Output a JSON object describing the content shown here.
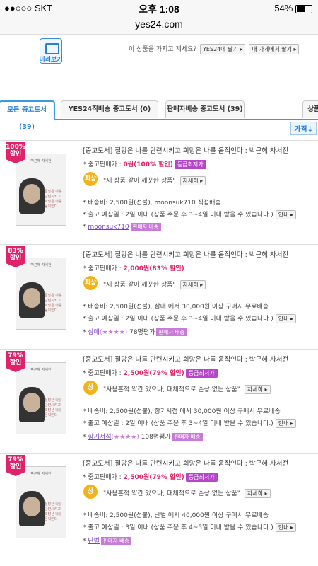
{
  "status": {
    "carrier": "●●○○○ SKT",
    "time": "오후 1:08",
    "battery": "54%"
  },
  "url": "yes24.com",
  "top": {
    "preview_label": "미리보기",
    "have_text": "이 상품을 가지고 계세요?",
    "btn_sell_yes24": "YES24에 팔기 ▸",
    "btn_sell_mystore": "내 가게에서 팔기 ▸"
  },
  "tabs": [
    "모든 중고도서 (39)",
    "YES24직배송 중고도서 (0)",
    "판매자배송 중고도서 (39)",
    "상품"
  ],
  "sort_label": "가격↓",
  "items": [
    {
      "discount": "100%",
      "disc_word": "할인",
      "title": "[중고도서] 절망은 나를 단련시키고 희망은 나를 움직인다 : 박근혜 자서전",
      "price_label": "* 중고판매가 :",
      "price": "0원",
      "pct": "(100% 할인)",
      "best": "등급최저가",
      "grade": "최상",
      "quote": "\"새 상품 같이 깨끗한 상품\"",
      "detail": "자세히 ▸",
      "ship": "* 배송비: 2,500원(선불), moonsuk710 직접배송",
      "eta": "* 출고 예상일 : 2일 이내 (상품 주문 후 3~4일 이내 받을 수 있습니다.)",
      "guide": "안내 ▸",
      "seller": "moonsuk710",
      "seller_badge": "판매자 배송",
      "stars": "",
      "rating": ""
    },
    {
      "discount": "83%",
      "disc_word": "할인",
      "title": "[중고도서] 절망은 나를 단련시키고 희망은 나를 움직인다 : 박근혜 자서전",
      "price_label": "* 중고판매가 :",
      "price": "2,000원",
      "pct": "(83% 할인)",
      "best": "",
      "grade": "최상",
      "quote": "\"새 상품 같이 깨끗한 상품\"",
      "detail": "자세히 ▸",
      "ship": "* 배송비: 2,500원(선불), 삼매 에서 30,000원 이상 구매시 무료배송",
      "eta": "* 출고 예상일 : 2일 이내 (상품 주문 후 3~4일 이내 받을 수 있습니다.)",
      "guide": "안내 ▸",
      "seller": "삼매",
      "seller_badge": "판매자 배송",
      "stars": "(★★★★)",
      "rating": "78명평가"
    },
    {
      "discount": "79%",
      "disc_word": "할인",
      "title": "[중고도서] 절망은 나를 단련시키고 희망은 나를 움직인다 : 박근혜 자서전",
      "price_label": "* 중고판매가 :",
      "price": "2,500원",
      "pct": "(79% 할인)",
      "best": "등급최저가",
      "grade": "상",
      "quote": "\"사용흔적 약간 있으나, 대체적으로 손상 없는 상품\"",
      "detail": "자세히 ▸",
      "ship": "* 배송비: 2,500원(선불), 향기서점 에서 30,000원 이상 구매시 무료배송",
      "eta": "* 출고 예상일 : 2일 이내 (상품 주문 후 3~4일 이내 받을 수 있습니다.)",
      "guide": "안내 ▸",
      "seller": "향기서점",
      "seller_badge": "판매자 배송",
      "stars": "(★★★★)",
      "rating": "108명평가"
    },
    {
      "discount": "79%",
      "disc_word": "할인",
      "title": "[중고도서] 절망은 나를 단련시키고 희망은 나를 움직인다 : 박근혜 자서전",
      "price_label": "* 중고판매가 :",
      "price": "2,500원",
      "pct": "(79% 할인)",
      "best": "등급최저가",
      "grade": "상",
      "quote": "\"사용흔적 약간 있으나, 대체적으로 손상 없는 상품\"",
      "detail": "자세히 ▸",
      "ship": "* 배송비: 2,500원(선불), 난벌 에서 40,000원 이상 구매시 무료배송",
      "eta": "* 출고 예상일 : 3일 이내 (상품 주문 후 4~5일 이내 받을 수 있습니다.)",
      "guide": "안내 ▸",
      "seller": "난벌",
      "seller_badge": "판매자 배송",
      "stars": "",
      "rating": ""
    }
  ],
  "cover": {
    "title": "박근혜 자서전",
    "text": "절망은 나를 단련시키고 희망은 나를 움직인다"
  }
}
